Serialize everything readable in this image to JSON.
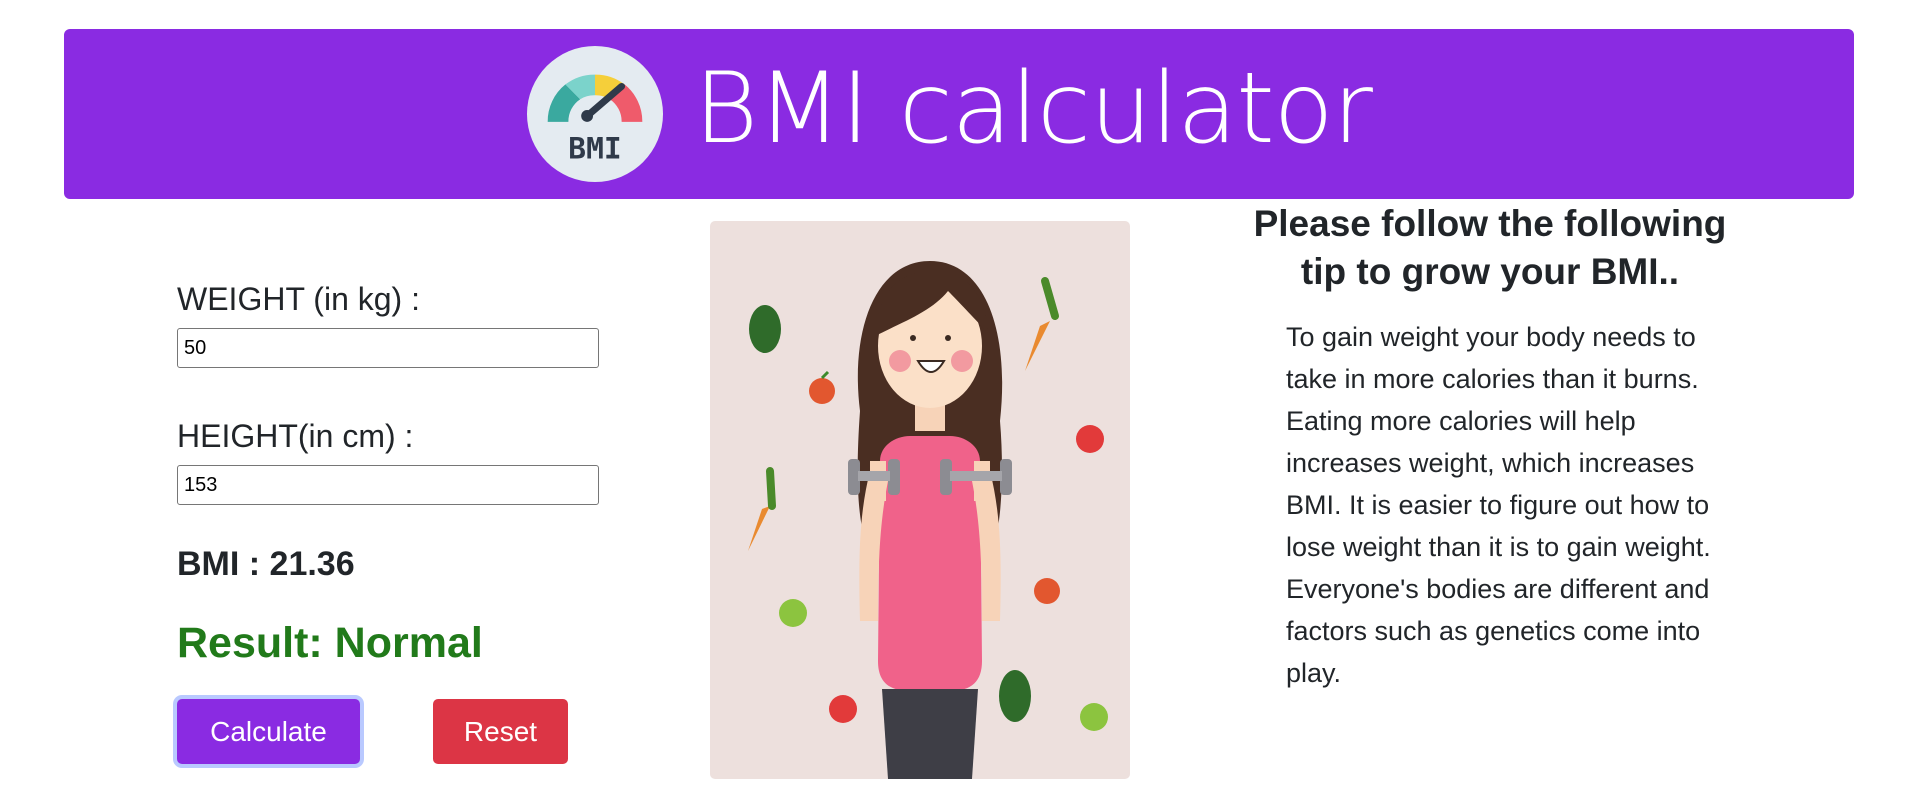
{
  "header": {
    "title": "BMI calculator",
    "logo_text": "BMI",
    "background_color": "#8a2be2"
  },
  "form": {
    "weight_label": "WEIGHT (in kg) :",
    "weight_value": "50",
    "height_label": "HEIGHT(in cm) :",
    "height_value": "153",
    "bmi_text": "BMI : 21.36",
    "result_text": "Result: Normal",
    "result_color": "#217a1a"
  },
  "buttons": {
    "calculate_label": "Calculate",
    "calculate_color": "#8a2be2",
    "reset_label": "Reset",
    "reset_color": "#dc3545"
  },
  "illustration": {
    "icon": "woman-lifting-dumbbells-with-fruits-vegetables"
  },
  "tip": {
    "heading_line1": "Please follow the following",
    "heading_line2": "tip to grow your BMI..",
    "body_lines": [
      "To gain weight your body needs to",
      "take in more calories than it burns.",
      "Eating more calories will help",
      "increases weight, which increases",
      "BMI. It is easier to figure out how to",
      "lose weight than it is to gain weight.",
      "Everyone's bodies are different and",
      "factors such as genetics come into",
      "play."
    ]
  }
}
